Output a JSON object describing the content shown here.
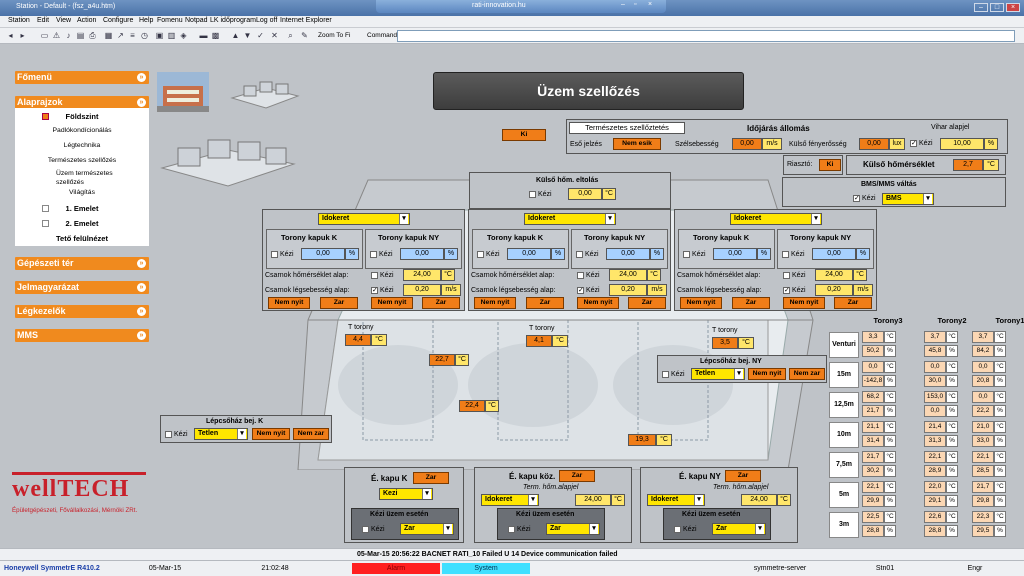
{
  "window": {
    "title": "Station - Default - (fsz_a4u.htm)",
    "remote_title": "rati-innovation.hu"
  },
  "menu": [
    "Station",
    "Edit",
    "View",
    "Action",
    "Configure",
    "Help",
    "Fomenu",
    "Notpad",
    "LK időprogram",
    "Log off",
    "Internet Explorer"
  ],
  "toolbar": {
    "zoom": "Zoom To Fi",
    "command_label": "Command",
    "command_value": ""
  },
  "nav": {
    "fomenu": "Főmenü",
    "alaprajzok": "Alaprajzok",
    "items": [
      "Földszint",
      "Padlókondícionálás",
      "Légtechnika",
      "Természetes szellőzés",
      "Üzem természetes szellőzés",
      "Világítás",
      "1. Emelet",
      "2. Emelet",
      "Tető felülnézet"
    ],
    "gepeszeti": "Gépészeti tér",
    "jelmagyarazat": "Jelmagyarázat",
    "legkezelok": "Légkezelők",
    "mms": "MMS"
  },
  "page_title": "Üzem szellőzés",
  "ki_button": "Ki",
  "weather": {
    "tab": "Természetes szellőztetés",
    "title": "Időjárás állomás",
    "eso_label": "Eső jelzés",
    "eso_value": "Nem esik",
    "szel_label": "Szélsebesség",
    "szel_value": "0,00",
    "szel_unit": "m/s",
    "feny_label": "Külső fényerősség",
    "feny_value": "0,00",
    "feny_unit": "lux",
    "vihar_label": "Vihar alapjel",
    "kezi": "Kézi",
    "vihar_value": "10,00",
    "vihar_unit": "%"
  },
  "riaszto": {
    "label": "Riasztó:",
    "value": "Ki",
    "kulso_label": "Külső hőmérséklet",
    "kulso_value": "2,7",
    "kulso_unit": "°C"
  },
  "bms": {
    "title": "BMS/MMS váltás",
    "kezi": "Kézi",
    "value": "BMS"
  },
  "eltolas": {
    "title": "Külső hőm. eltolás",
    "kezi": "Kézi",
    "value": "0,00",
    "unit": "°C"
  },
  "towers": [
    {
      "mode": "Idokeret",
      "k_label": "Torony kapuk K",
      "ny_label": "Torony kapuk NY",
      "k_value": "0,00",
      "ny_value": "0,00",
      "unit": "%",
      "hom_label": "Csarnok hőmérséklet alap:",
      "hom_value": "24,00",
      "hom_unit": "°C",
      "leg_label": "Csarnok légsebesség alap:",
      "leg_value": "0,20",
      "leg_unit": "m/s",
      "kezi": "Kézi",
      "btn_nyit": "Nem nyit",
      "btn_zar": "Zar"
    },
    {
      "mode": "Idokeret",
      "k_label": "Torony kapuk K",
      "ny_label": "Torony kapuk NY",
      "k_value": "0,00",
      "ny_value": "0,00",
      "unit": "%",
      "hom_label": "Csarnok hőmérséklet alap:",
      "hom_value": "24,00",
      "hom_unit": "°C",
      "leg_label": "Csarnok légsebesség alap:",
      "leg_value": "0,20",
      "leg_unit": "m/s",
      "kezi": "Kézi",
      "btn_nyit": "Nem nyit",
      "btn_zar": "Zar"
    },
    {
      "mode": "Idokeret",
      "k_label": "Torony kapuk K",
      "ny_label": "Torony kapuk NY",
      "k_value": "0,00",
      "ny_value": "0,00",
      "unit": "%",
      "hom_label": "Csarnok hőmérséklet alap:",
      "hom_value": "24,00",
      "hom_unit": "°C",
      "leg_label": "Csarnok légsebesség alap:",
      "leg_value": "0,20",
      "leg_unit": "m/s",
      "kezi": "Kézi",
      "btn_nyit": "Nem nyit",
      "btn_zar": "Zar"
    }
  ],
  "ttorony": [
    {
      "label": "T torony",
      "value": "4,4",
      "unit": "°C"
    },
    {
      "label": "T torony",
      "value": "4,1",
      "unit": "°C"
    },
    {
      "label": "T torony",
      "value": "3,5",
      "unit": "°C"
    }
  ],
  "floor_temps": [
    {
      "value": "22,7",
      "unit": "°C"
    },
    {
      "value": "22,4",
      "unit": "°C"
    },
    {
      "value": "19,3",
      "unit": "°C"
    }
  ],
  "lepcso_ny": {
    "title": "Lépcsőház bej. NY",
    "kezi": "Kézi",
    "mode": "Tetlen",
    "btn_nyit": "Nem nyit",
    "btn_zar": "Nem zar"
  },
  "lepcso_k": {
    "title": "Lépcsőház bej. K",
    "kezi": "Kézi",
    "mode": "Tetlen",
    "btn_nyit": "Nem nyit",
    "btn_zar": "Nem zar"
  },
  "kapuk": [
    {
      "title": "É. kapu K",
      "btn": "Zar",
      "mode": "Kezi",
      "kezi_title": "Kézi üzem esetén",
      "kezi": "Kézi",
      "kezi_value": "Zar"
    },
    {
      "title": "É. kapu köz.",
      "btn": "Zar",
      "mode": "Idokeret",
      "alap_label": "Term. hőm.alapjel",
      "alap_value": "24,00",
      "alap_unit": "°C",
      "kezi_title": "Kézi üzem esetén",
      "kezi": "Kézi",
      "kezi_value": "Zar"
    },
    {
      "title": "É. kapu NY",
      "btn": "Zar",
      "mode": "Idokeret",
      "alap_label": "Term. hőm.alapjel",
      "alap_value": "24,00",
      "alap_unit": "°C",
      "kezi_title": "Kézi üzem esetén",
      "kezi": "Kézi",
      "kezi_value": "Zar"
    }
  ],
  "tower_table": {
    "headers": [
      "Torony3",
      "Torony2",
      "Torony1"
    ],
    "rows": [
      {
        "label": "Venturi",
        "cells": [
          [
            "3,3",
            "°C"
          ],
          [
            "3,7",
            "°C"
          ],
          [
            "3,7",
            "°C"
          ],
          [
            "50,2",
            "%"
          ],
          [
            "45,8",
            "%"
          ],
          [
            "84,2",
            "%"
          ]
        ]
      },
      {
        "label": "15m",
        "cells": [
          [
            "0,0",
            "°C"
          ],
          [
            "0,0",
            "°C"
          ],
          [
            "0,0",
            "°C"
          ],
          [
            "-142,8",
            "%"
          ],
          [
            "30,0",
            "%"
          ],
          [
            "20,8",
            "%"
          ]
        ]
      },
      {
        "label": "12,5m",
        "cells": [
          [
            "68,2",
            "°C"
          ],
          [
            "153,0",
            "°C"
          ],
          [
            "0,0",
            "°C"
          ],
          [
            "21,7",
            "%"
          ],
          [
            "0,0",
            "%"
          ],
          [
            "22,2",
            "%"
          ]
        ]
      },
      {
        "label": "10m",
        "cells": [
          [
            "21,1",
            "°C"
          ],
          [
            "21,4",
            "°C"
          ],
          [
            "21,0",
            "°C"
          ],
          [
            "31,4",
            "%"
          ],
          [
            "31,3",
            "%"
          ],
          [
            "33,0",
            "%"
          ]
        ]
      },
      {
        "label": "7,5m",
        "cells": [
          [
            "21,7",
            "°C"
          ],
          [
            "22,1",
            "°C"
          ],
          [
            "22,1",
            "°C"
          ],
          [
            "30,2",
            "%"
          ],
          [
            "28,9",
            "%"
          ],
          [
            "28,5",
            "%"
          ]
        ]
      },
      {
        "label": "5m",
        "cells": [
          [
            "22,1",
            "°C"
          ],
          [
            "22,0",
            "°C"
          ],
          [
            "21,7",
            "°C"
          ],
          [
            "29,9",
            "%"
          ],
          [
            "29,1",
            "%"
          ],
          [
            "29,8",
            "%"
          ]
        ]
      },
      {
        "label": "3m",
        "cells": [
          [
            "22,5",
            "°C"
          ],
          [
            "22,6",
            "°C"
          ],
          [
            "22,3",
            "°C"
          ],
          [
            "28,8",
            "%"
          ],
          [
            "28,8",
            "%"
          ],
          [
            "29,5",
            "%"
          ]
        ]
      }
    ]
  },
  "logo": {
    "brand": "wellTECH",
    "tagline": "Épületgépészeti, Fővállalkozási, Mérnöki ZRt."
  },
  "status": {
    "message": "05-Mar-15  20:56:22  BACNET   RATI_10   Failed   U 14 Device communication failed",
    "product": "Honeywell SymmetrE R410.2",
    "date": "05-Mar-15",
    "time": "21:02:48",
    "alarm": "Alarm",
    "system": "System",
    "server": "symmetre-server",
    "station": "Stn01",
    "user": "Engr"
  },
  "colors": {
    "orange": "#f07d18",
    "yellow": "#ffe66a",
    "blue": "#a7d1ff",
    "alarm": "#ff2020",
    "system": "#3fe0ff"
  }
}
